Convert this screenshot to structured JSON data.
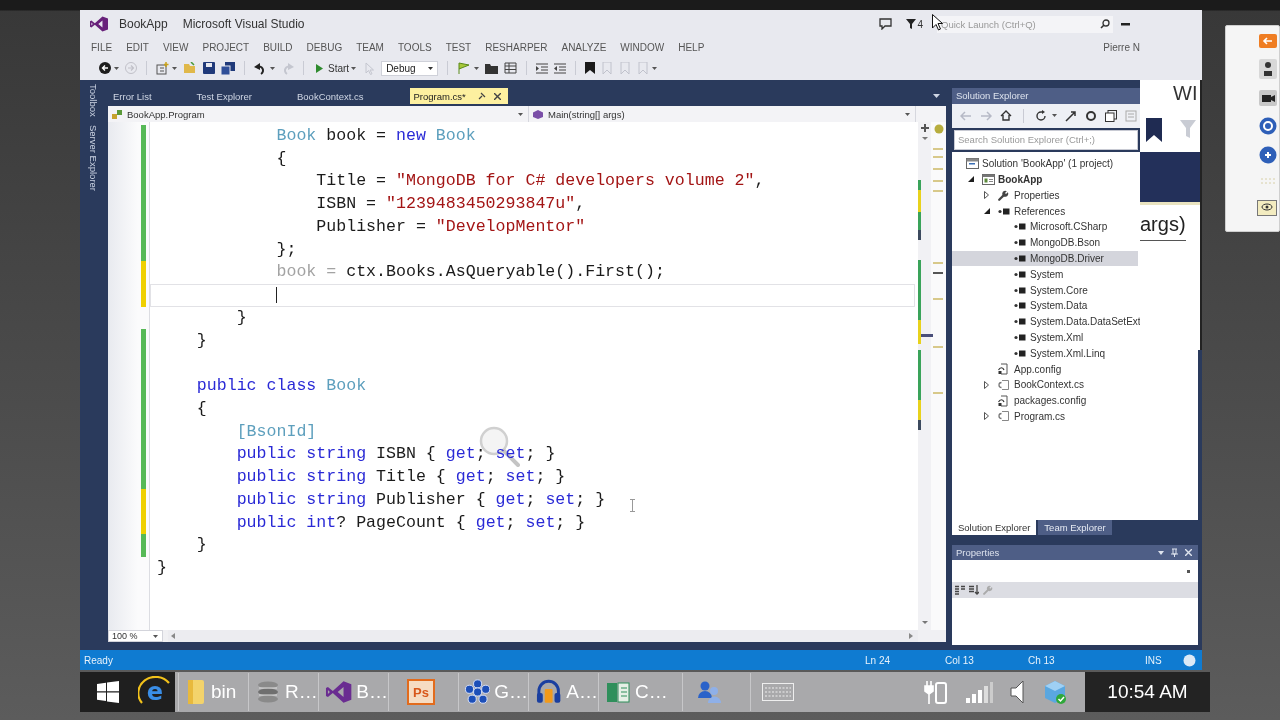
{
  "window": {
    "title": "BookApp",
    "app_name": "Microsoft Visual Studio",
    "notification_count": "4",
    "quick_launch": {
      "placeholder": "Quick Launch (Ctrl+Q)"
    },
    "user": "Pierre N"
  },
  "menu": [
    "FILE",
    "EDIT",
    "VIEW",
    "PROJECT",
    "BUILD",
    "DEBUG",
    "TEAM",
    "TOOLS",
    "TEST",
    "RESHARPER",
    "ANALYZE",
    "WINDOW",
    "HELP"
  ],
  "toolbar": {
    "start_label": "Start",
    "configuration": "Debug"
  },
  "side_tabs": [
    "Toolbox",
    "Server Explorer"
  ],
  "document_tabs": [
    {
      "label": "Error List",
      "selected": false
    },
    {
      "label": "Test Explorer",
      "selected": false
    },
    {
      "label": "BookContext.cs",
      "selected": false
    },
    {
      "label": "Program.cs*",
      "selected": true
    }
  ],
  "navigation_bar": {
    "type_selector": "BookApp.Program",
    "member_selector": "Main(string[] args)"
  },
  "editor": {
    "lines": [
      {
        "kind": "code",
        "color": "#57b957",
        "tokens": [
          {
            "text": "            Book",
            "kind": "type"
          },
          {
            "text": " book = ",
            "kind": "plain"
          },
          {
            "text": "new",
            "kind": "keyword"
          },
          {
            "text": " Book",
            "kind": "type"
          }
        ]
      },
      {
        "kind": "code",
        "color": "#57b957",
        "tokens": [
          {
            "text": "            {",
            "kind": "plain"
          }
        ]
      },
      {
        "kind": "code",
        "color": "#57b957",
        "tokens": [
          {
            "text": "                Title = ",
            "kind": "plain"
          },
          {
            "text": "\"MongoDB for C# developers volume 2\"",
            "kind": "string"
          },
          {
            "text": ",",
            "kind": "plain"
          }
        ]
      },
      {
        "kind": "code",
        "color": "#57b957",
        "tokens": [
          {
            "text": "                ISBN = ",
            "kind": "plain"
          },
          {
            "text": "\"1239483450293847u\"",
            "kind": "string"
          },
          {
            "text": ",",
            "kind": "plain"
          }
        ]
      },
      {
        "kind": "code",
        "color": "#57b957",
        "tokens": [
          {
            "text": "                Publisher = ",
            "kind": "plain"
          },
          {
            "text": "\"DevelopMentor\"",
            "kind": "string"
          }
        ]
      },
      {
        "kind": "code",
        "color": "#57b957",
        "tokens": [
          {
            "text": "            };",
            "kind": "plain"
          }
        ]
      },
      {
        "kind": "code",
        "color": "#efd000",
        "tokens": [
          {
            "text": "            book = ",
            "kind": "dim"
          },
          {
            "text": "ctx.Books.AsQueryable().First();",
            "kind": "plain"
          }
        ]
      },
      {
        "kind": "caret",
        "color": "#efd000"
      },
      {
        "kind": "code",
        "tokens": [
          {
            "text": "        }",
            "kind": "plain"
          }
        ]
      },
      {
        "kind": "code",
        "color": "#57b957",
        "tokens": [
          {
            "text": "    }",
            "kind": "plain"
          }
        ]
      },
      {
        "kind": "blank",
        "color": "#57b957"
      },
      {
        "kind": "code",
        "color": "#57b957",
        "tokens": [
          {
            "text": "    public class",
            "kind": "keyword"
          },
          {
            "text": " Book",
            "kind": "type"
          }
        ]
      },
      {
        "kind": "code",
        "color": "#57b957",
        "tokens": [
          {
            "text": "    {",
            "kind": "plain"
          }
        ]
      },
      {
        "kind": "code",
        "color": "#57b957",
        "tokens": [
          {
            "text": "        [BsonId]",
            "kind": "type"
          }
        ]
      },
      {
        "kind": "code",
        "color": "#57b957",
        "tokens": [
          {
            "text": "        public string",
            "kind": "keyword"
          },
          {
            "text": " ISBN { ",
            "kind": "plain"
          },
          {
            "text": "get",
            "kind": "keyword"
          },
          {
            "text": "; ",
            "kind": "plain"
          },
          {
            "text": "set",
            "kind": "keyword"
          },
          {
            "text": "; }",
            "kind": "plain"
          }
        ]
      },
      {
        "kind": "code",
        "color": "#57b957",
        "tokens": [
          {
            "text": "        public string",
            "kind": "keyword"
          },
          {
            "text": " Title { ",
            "kind": "plain"
          },
          {
            "text": "get",
            "kind": "keyword"
          },
          {
            "text": "; ",
            "kind": "plain"
          },
          {
            "text": "set",
            "kind": "keyword"
          },
          {
            "text": "; }",
            "kind": "plain"
          }
        ]
      },
      {
        "kind": "code",
        "color": "#efd000",
        "tokens": [
          {
            "text": "        public string",
            "kind": "keyword"
          },
          {
            "text": " Publisher { ",
            "kind": "plain"
          },
          {
            "text": "get",
            "kind": "keyword"
          },
          {
            "text": "; ",
            "kind": "plain"
          },
          {
            "text": "set",
            "kind": "keyword"
          },
          {
            "text": "; }",
            "kind": "plain"
          }
        ]
      },
      {
        "kind": "code",
        "color": "#efd000",
        "tokens": [
          {
            "text": "        public int",
            "kind": "keyword"
          },
          {
            "text": "? PageCount { ",
            "kind": "plain"
          },
          {
            "text": "get",
            "kind": "keyword"
          },
          {
            "text": "; ",
            "kind": "plain"
          },
          {
            "text": "set",
            "kind": "keyword"
          },
          {
            "text": "; }",
            "kind": "plain"
          }
        ]
      },
      {
        "kind": "code",
        "color": "#57b957",
        "tokens": [
          {
            "text": "    }",
            "kind": "plain"
          }
        ]
      },
      {
        "kind": "code",
        "tokens": [
          {
            "text": "}",
            "kind": "plain"
          }
        ]
      }
    ],
    "zoom": "100 %"
  },
  "solution_explorer": {
    "title": "Solution Explorer",
    "search": {
      "placeholder": "Search Solution Explorer (Ctrl+;)"
    },
    "tree": [
      {
        "label": "Solution 'BookApp' (1 project)",
        "kind": "solution",
        "selected": false,
        "children": [
          {
            "label": "BookApp",
            "kind": "project",
            "expanded": true,
            "selected": false,
            "children": [
              {
                "label": "Properties",
                "kind": "properties",
                "expanded": false,
                "selected": false
              },
              {
                "label": "References",
                "kind": "references",
                "expanded": true,
                "selected": false,
                "children": [
                  {
                    "label": "Microsoft.CSharp",
                    "kind": "reference",
                    "selected": false
                  },
                  {
                    "label": "MongoDB.Bson",
                    "kind": "reference",
                    "selected": false
                  },
                  {
                    "label": "MongoDB.Driver",
                    "kind": "reference",
                    "selected": true
                  },
                  {
                    "label": "System",
                    "kind": "reference",
                    "selected": false
                  },
                  {
                    "label": "System.Core",
                    "kind": "reference",
                    "selected": false
                  },
                  {
                    "label": "System.Data",
                    "kind": "reference",
                    "selected": false
                  },
                  {
                    "label": "System.Data.DataSetExt",
                    "kind": "reference",
                    "selected": false
                  },
                  {
                    "label": "System.Xml",
                    "kind": "reference",
                    "selected": false
                  },
                  {
                    "label": "System.Xml.Linq",
                    "kind": "reference",
                    "selected": false
                  }
                ]
              },
              {
                "label": "App.config",
                "kind": "config",
                "selected": false
              },
              {
                "label": "BookContext.cs",
                "kind": "code",
                "expanded": false,
                "selected": false
              },
              {
                "label": "packages.config",
                "kind": "config",
                "selected": false
              },
              {
                "label": "Program.cs",
                "kind": "code",
                "expanded": false,
                "selected": false
              }
            ]
          }
        ]
      }
    ],
    "tabs": [
      {
        "label": "Solution Explorer",
        "selected": true
      },
      {
        "label": "Team Explorer",
        "selected": false
      }
    ]
  },
  "properties": {
    "title": "Properties"
  },
  "status_bar": {
    "message": "Ready",
    "line": "Ln 24",
    "column": "Col 13",
    "character": "Ch 13",
    "mode": "INS"
  },
  "background_window": {
    "heading": "WI",
    "text": "args)"
  },
  "taskbar": {
    "browser_logo": "e",
    "apps": [
      {
        "kind": "folder",
        "label": "bin"
      },
      {
        "kind": "database",
        "label": "R…"
      },
      {
        "kind": "visual-studio",
        "label": "B…"
      },
      {
        "kind": "tile",
        "logo_text": "Ps"
      },
      {
        "kind": "circles",
        "label": "G…"
      },
      {
        "kind": "headphones",
        "label": "A…"
      },
      {
        "kind": "book",
        "label": "C…"
      }
    ],
    "clock": "10:54 AM"
  }
}
